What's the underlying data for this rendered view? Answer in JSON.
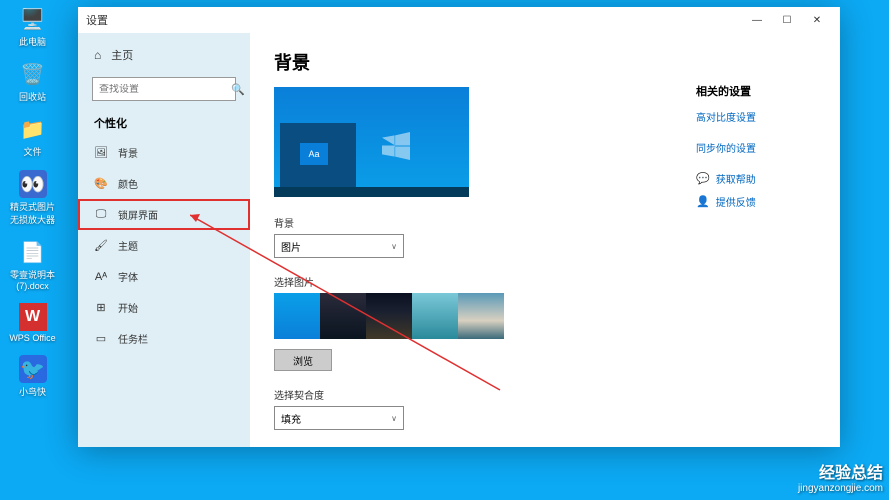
{
  "desktop": {
    "icons": [
      {
        "label": "此电脑",
        "glyph": "🖥️"
      },
      {
        "label": "回收站",
        "glyph": "🗑️"
      },
      {
        "label": "文件",
        "glyph": "📁"
      },
      {
        "label": "精灵式图片无损放大器",
        "glyph": "👀"
      },
      {
        "label": "零壹说明本(7).docx",
        "glyph": "📄"
      },
      {
        "label": "WPS Office",
        "glyph": "W"
      },
      {
        "label": "小鸟快",
        "glyph": "🐦"
      }
    ]
  },
  "window": {
    "title": "设置",
    "controls": {
      "min": "—",
      "max": "☐",
      "close": "✕"
    }
  },
  "sidebar": {
    "home": {
      "label": "主页",
      "icon": "⌂"
    },
    "search_placeholder": "查找设置",
    "category": "个性化",
    "items": [
      {
        "icon": "🖼",
        "label": "背景"
      },
      {
        "icon": "🎨",
        "label": "颜色"
      },
      {
        "icon": "🖵",
        "label": "锁屏界面"
      },
      {
        "icon": "🖌",
        "label": "主题"
      },
      {
        "icon": "Aᴬ",
        "label": "字体"
      },
      {
        "icon": "⊞",
        "label": "开始"
      },
      {
        "icon": "▭",
        "label": "任务栏"
      }
    ],
    "highlighted_index": 2
  },
  "content": {
    "heading": "背景",
    "preview_text": "Aa",
    "bg_label": "背景",
    "bg_value": "图片",
    "pick_label": "选择图片",
    "browse_btn": "浏览",
    "fit_label": "选择契合度",
    "fit_value": "填充"
  },
  "right": {
    "related_heading": "相关的设置",
    "links": [
      "高对比度设置",
      "同步你的设置"
    ],
    "actions": [
      {
        "icon": "💬",
        "label": "获取帮助"
      },
      {
        "icon": "👤",
        "label": "提供反馈"
      }
    ]
  },
  "watermark": {
    "main": "经验总结",
    "sub": "jingyanzongjie.com"
  }
}
